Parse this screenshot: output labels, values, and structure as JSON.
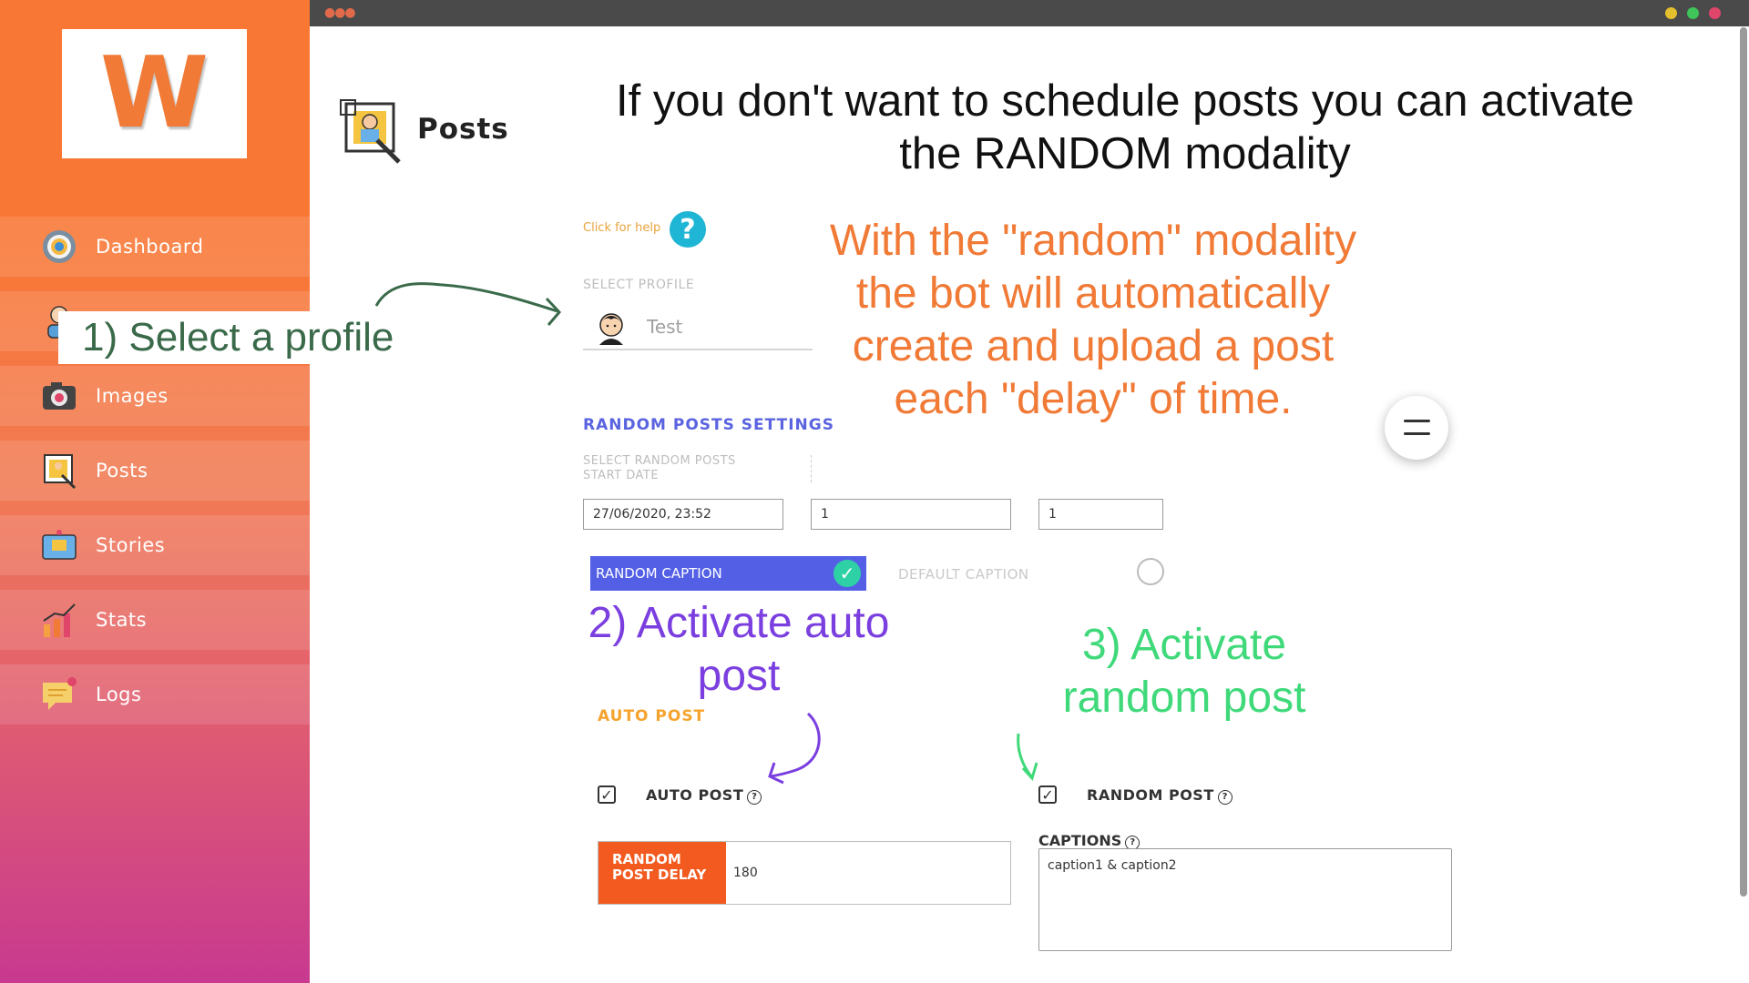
{
  "app": {
    "logo_letter": "W",
    "accent_color": "#f97735",
    "topbar_dots": "●●●"
  },
  "sidebar": {
    "items": [
      {
        "label": "Dashboard",
        "icon": "dashboard-icon"
      },
      {
        "label": "",
        "icon": "profiles-icon"
      },
      {
        "label": "Images",
        "icon": "camera-icon"
      },
      {
        "label": "Posts",
        "icon": "posts-icon"
      },
      {
        "label": "Stories",
        "icon": "stories-icon"
      },
      {
        "label": "Stats",
        "icon": "stats-icon"
      },
      {
        "label": "Logs",
        "icon": "logs-icon"
      }
    ]
  },
  "page": {
    "title": "Posts",
    "headline": "If you don't want to schedule posts you can activate the RANDOM modality",
    "help_link": "Click for help",
    "help_button": "?"
  },
  "profile": {
    "select_label": "SELECT PROFILE",
    "selected_name": "Test"
  },
  "random_settings": {
    "title": "RANDOM POSTS SETTINGS",
    "start_date_label": "SELECT RANDOM POSTS START DATE",
    "start_date_value": "27/06/2020, 23:52",
    "second_value": "1",
    "third_value": "1",
    "random_caption_label": "RANDOM CAPTION",
    "random_caption_checked": true,
    "default_caption_label": "DEFAULT CAPTION",
    "default_caption_checked": false
  },
  "auto_post": {
    "section_title": "AUTO POST",
    "auto_post_label": "AUTO POST",
    "auto_post_checked": true,
    "random_post_label": "RANDOM POST",
    "random_post_checked": true,
    "delay_label": "RANDOM POST DELAY",
    "delay_value": "180",
    "captions_label": "CAPTIONS",
    "captions_value": "caption1 & caption2"
  },
  "annotations": {
    "step1": "1) Select a profile",
    "random_explanation": "With the \"random\" modality the bot will automatically create and upload a post each \"delay\" of time.",
    "step2": "2) Activate auto post",
    "step3": "3) Activate random post"
  }
}
